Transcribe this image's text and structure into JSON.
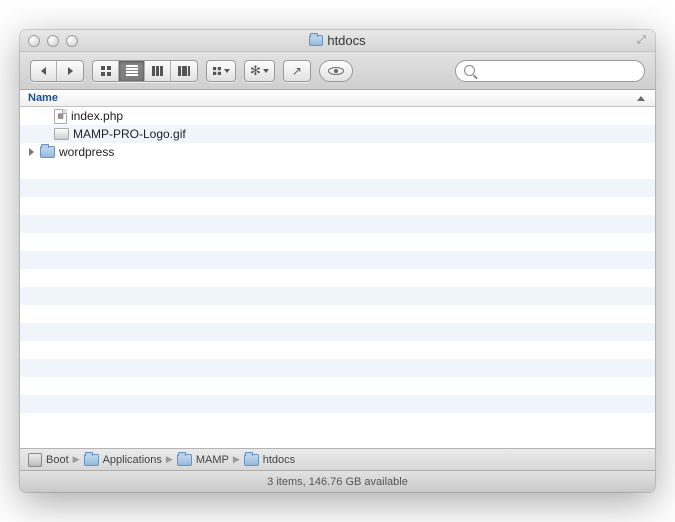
{
  "window": {
    "title": "htdocs"
  },
  "header": {
    "name_col": "Name"
  },
  "files": [
    {
      "name": "index.php",
      "type": "php",
      "expandable": false
    },
    {
      "name": "MAMP-PRO-Logo.gif",
      "type": "gif",
      "expandable": false
    },
    {
      "name": "wordpress",
      "type": "folder",
      "expandable": true
    }
  ],
  "path": [
    {
      "label": "Boot",
      "icon": "drive"
    },
    {
      "label": "Applications",
      "icon": "folder"
    },
    {
      "label": "MAMP",
      "icon": "folder"
    },
    {
      "label": "htdocs",
      "icon": "folder"
    }
  ],
  "status": {
    "text": "3 items, 146.76 GB available"
  },
  "search": {
    "placeholder": ""
  }
}
